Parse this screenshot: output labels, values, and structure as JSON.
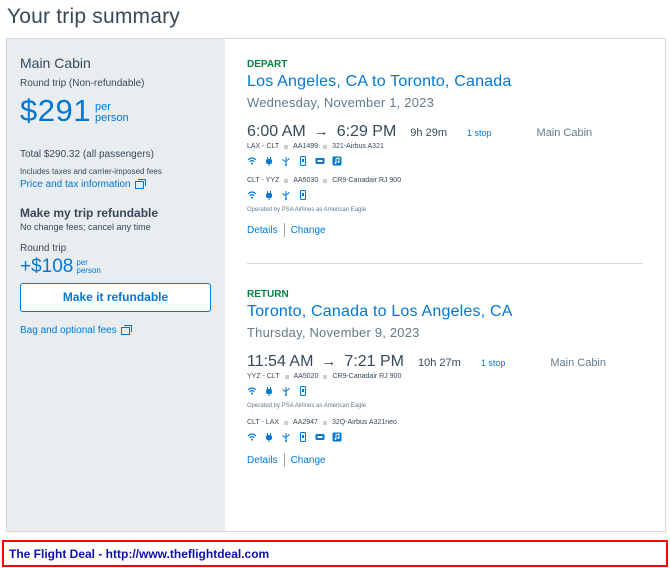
{
  "page": {
    "title": "Your trip summary"
  },
  "summary": {
    "cabin": "Main Cabin",
    "trip_type": "Round trip (Non-refundable)",
    "price": "$291",
    "per_line1": "per",
    "per_line2": "person",
    "total": "Total $290.32 (all passengers)",
    "taxes_note": "Includes taxes and carrier-imposed fees",
    "price_tax_link": "Price and tax information",
    "refundable_heading": "Make my trip refundable",
    "no_change_fees": "No change fees; cancel any time",
    "round_trip": "Round trip",
    "addon_price": "+$108",
    "addon_per1": "per",
    "addon_per2": "person",
    "refund_button": "Make it refundable",
    "bag_link": "Bag and optional fees"
  },
  "depart": {
    "label": "DEPART",
    "route": "Los Angeles, CA to Toronto, Canada",
    "date": "Wednesday, November 1, 2023",
    "dep_time": "6:00 AM",
    "arrow": "→",
    "arr_time": "6:29 PM",
    "duration": "9h 29m",
    "stops": "1 stop",
    "cabin": "Main Cabin",
    "legs": [
      {
        "route": "LAX - CLT",
        "flight": "AA1499",
        "aircraft": "321-Airbus A321",
        "operated": ""
      },
      {
        "route": "CLT - YYZ",
        "flight": "AA5030",
        "aircraft": "CR9-Canadair RJ 900",
        "operated": "Operated by PSA Airlines as American Eagle"
      }
    ],
    "details": "Details",
    "change": "Change"
  },
  "return": {
    "label": "RETURN",
    "route": "Toronto, Canada to Los Angeles, CA",
    "date": "Thursday, November 9, 2023",
    "dep_time": "11:54 AM",
    "arrow": "→",
    "arr_time": "7:21 PM",
    "duration": "10h 27m",
    "stops": "1 stop",
    "cabin": "Main Cabin",
    "legs": [
      {
        "route": "YYZ - CLT",
        "flight": "AA5020",
        "aircraft": "CR9-Canadair RJ 900",
        "operated": "Operated by PSA Airlines as American Eagle"
      },
      {
        "route": "CLT - LAX",
        "flight": "AA2947",
        "aircraft": "32Q-Airbus A321neo",
        "operated": ""
      }
    ],
    "details": "Details",
    "change": "Change"
  },
  "footer": {
    "text": "The Flight Deal - http://www.theflightdeal.com"
  },
  "colors": {
    "accent": "#0078d2",
    "green": "#00853f",
    "text": "#36495a",
    "panel": "#e9edf0",
    "footer_border": "#ff0000"
  }
}
